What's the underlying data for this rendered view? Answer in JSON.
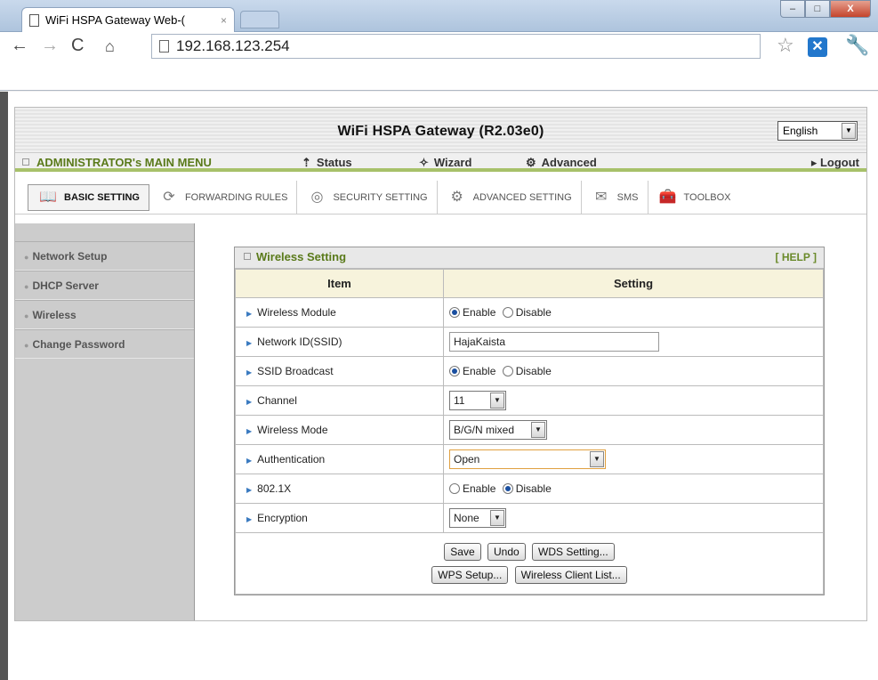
{
  "browser": {
    "tab_title": "WiFi HSPA Gateway Web-(",
    "tab_close": "×",
    "address": "192.168.123.254",
    "window_buttons": [
      "–",
      "□",
      "X"
    ]
  },
  "header": {
    "title": "WiFi HSPA Gateway  (R2.03e0)",
    "language": "English"
  },
  "menubar": {
    "admin_label": "ADMINISTRATOR's MAIN MENU",
    "status": "Status",
    "wizard": "Wizard",
    "advanced": "Advanced",
    "logout": "Logout"
  },
  "tabs": {
    "basic": "BASIC SETTING",
    "forwarding": "FORWARDING RULES",
    "security": "SECURITY SETTING",
    "advanced": "ADVANCED SETTING",
    "sms": "SMS",
    "toolbox": "TOOLBOX"
  },
  "sidebar": {
    "items": [
      {
        "label": "Network Setup"
      },
      {
        "label": "DHCP Server"
      },
      {
        "label": "Wireless"
      },
      {
        "label": "Change Password"
      }
    ]
  },
  "panel": {
    "title": "Wireless Setting",
    "help": "[ HELP ]",
    "col_item": "Item",
    "col_setting": "Setting",
    "rows": {
      "module": "Wireless Module",
      "ssid": "Network ID(SSID)",
      "broadcast": "SSID Broadcast",
      "channel": "Channel",
      "mode": "Wireless Mode",
      "auth": "Authentication",
      "dot1x": "802.1X",
      "encryption": "Encryption"
    },
    "enable": "Enable",
    "disable": "Disable",
    "ssid_value": "HajaKaista",
    "channel_value": "11",
    "mode_value": "B/G/N mixed",
    "auth_value": "Open",
    "encryption_value": "None"
  },
  "buttons": {
    "save": "Save",
    "undo": "Undo",
    "wds": "WDS Setting...",
    "wps": "WPS Setup...",
    "client_list": "Wireless Client List..."
  }
}
